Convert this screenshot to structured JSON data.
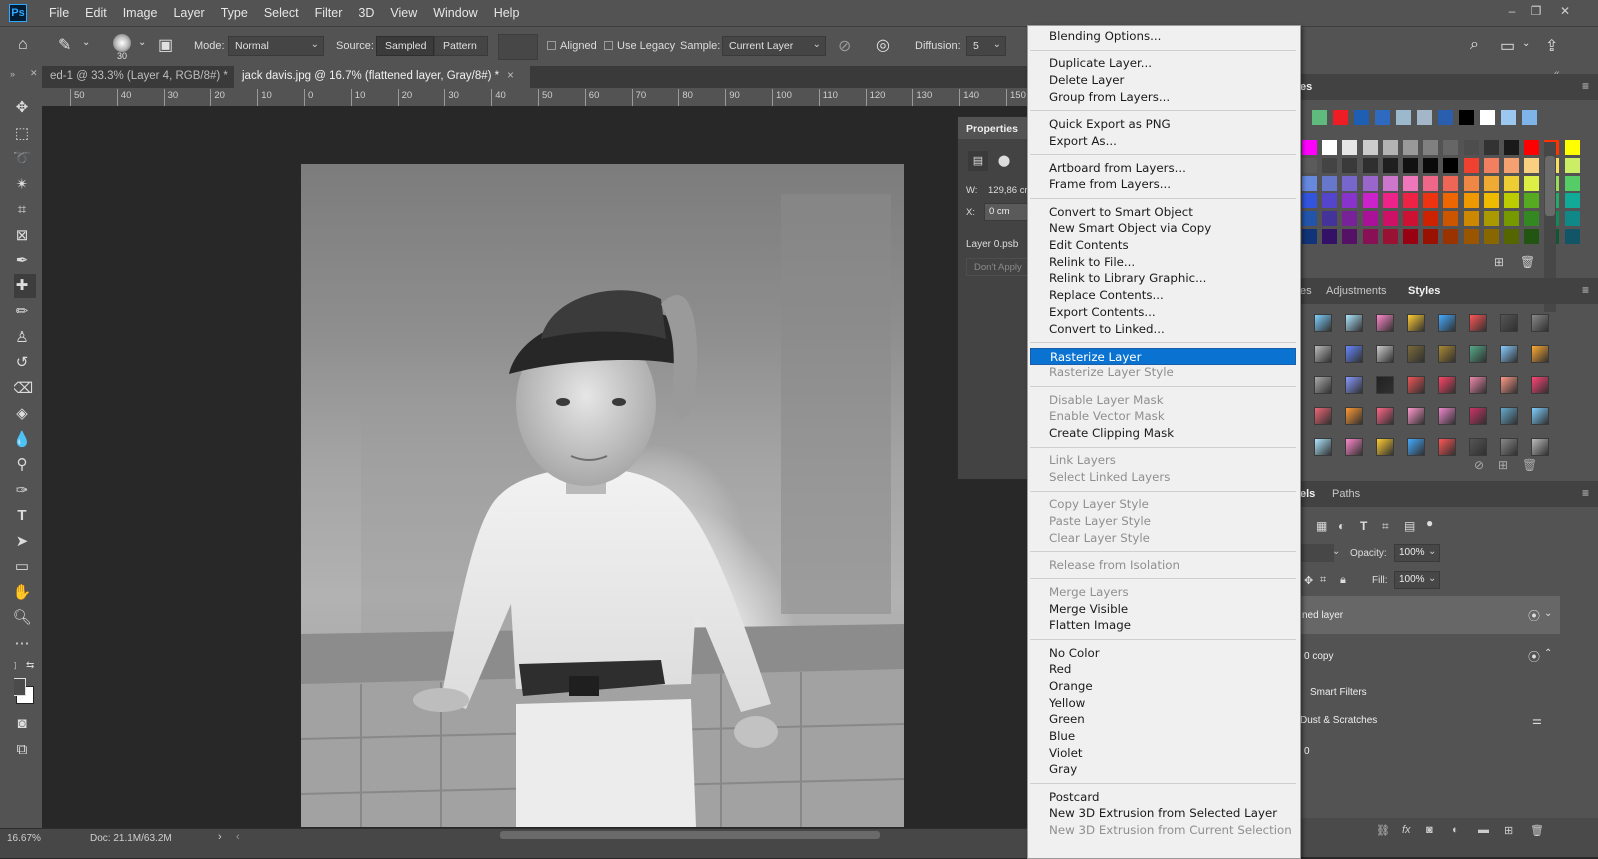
{
  "app": {
    "logo": "Ps"
  },
  "menubar": {
    "items": [
      "File",
      "Edit",
      "Image",
      "Layer",
      "Type",
      "Select",
      "Filter",
      "3D",
      "View",
      "Window",
      "Help"
    ]
  },
  "options": {
    "brush_size": "30",
    "mode_label": "Mode:",
    "mode_value": "Normal",
    "source_label": "Source:",
    "source_sampled": "Sampled",
    "source_pattern": "Pattern",
    "aligned_label": "Aligned",
    "use_legacy_label": "Use Legacy",
    "sample_label": "Sample:",
    "sample_value": "Current Layer",
    "diffusion_label": "Diffusion:",
    "diffusion_value": "5"
  },
  "tabs": [
    {
      "label": "ed-1 @ 33.3% (Layer 4, RGB/8#) *",
      "close": "×"
    },
    {
      "label": "jack davis.jpg @ 16.7% (flattened layer, Gray/8#) *",
      "close": "×"
    }
  ],
  "ruler": {
    "h_labels": [
      "50",
      "40",
      "30",
      "20",
      "10",
      "0",
      "10",
      "20",
      "30",
      "40",
      "50",
      "60",
      "70",
      "80",
      "90",
      "100",
      "110",
      "120",
      "130",
      "140",
      "150"
    ]
  },
  "status": {
    "zoom": "16.67%",
    "doc": "Doc: 21.1M/63.2M"
  },
  "properties": {
    "title": "Properties",
    "w_label": "W:",
    "w_value": "129,86 cr",
    "x_label": "X:",
    "x_value": "0 cm",
    "layer_name": "Layer 0.psb",
    "dont_apply": "Don't Apply"
  },
  "panels": {
    "swatches_tab": "es",
    "style_tabs": [
      "es",
      "Adjustments",
      "Styles"
    ],
    "layer_tabs": [
      "els",
      "Paths"
    ],
    "opacity_label": "Opacity:",
    "opacity_value": "100%",
    "fill_label": "Fill:",
    "fill_value": "100%",
    "layers": [
      "ned layer",
      "0 copy",
      "Smart Filters",
      "Dust & Scratches",
      "0"
    ]
  },
  "context_menu": {
    "items": [
      {
        "label": "Blending Options...",
        "disabled": false
      },
      {
        "sep": true
      },
      {
        "label": "Duplicate Layer...",
        "disabled": false
      },
      {
        "label": "Delete Layer",
        "disabled": false
      },
      {
        "label": "Group from Layers...",
        "disabled": false
      },
      {
        "sep": true
      },
      {
        "label": "Quick Export as PNG",
        "disabled": false
      },
      {
        "label": "Export As...",
        "disabled": false
      },
      {
        "sep": true
      },
      {
        "label": "Artboard from Layers...",
        "disabled": false
      },
      {
        "label": "Frame from Layers...",
        "disabled": false
      },
      {
        "sep": true
      },
      {
        "label": "Convert to Smart Object",
        "disabled": false
      },
      {
        "label": "New Smart Object via Copy",
        "disabled": false
      },
      {
        "label": "Edit Contents",
        "disabled": false
      },
      {
        "label": "Relink to File...",
        "disabled": false
      },
      {
        "label": "Relink to Library Graphic...",
        "disabled": false
      },
      {
        "label": "Replace Contents...",
        "disabled": false
      },
      {
        "label": "Export Contents...",
        "disabled": false
      },
      {
        "label": "Convert to Linked...",
        "disabled": false
      },
      {
        "sep": true
      },
      {
        "label": "Rasterize Layer",
        "disabled": false,
        "highlighted": true
      },
      {
        "label": "Rasterize Layer Style",
        "disabled": true
      },
      {
        "sep": true
      },
      {
        "label": "Disable Layer Mask",
        "disabled": true
      },
      {
        "label": "Enable Vector Mask",
        "disabled": true
      },
      {
        "label": "Create Clipping Mask",
        "disabled": false
      },
      {
        "sep": true
      },
      {
        "label": "Link Layers",
        "disabled": true
      },
      {
        "label": "Select Linked Layers",
        "disabled": true
      },
      {
        "sep": true
      },
      {
        "label": "Copy Layer Style",
        "disabled": true
      },
      {
        "label": "Paste Layer Style",
        "disabled": true
      },
      {
        "label": "Clear Layer Style",
        "disabled": true
      },
      {
        "sep": true
      },
      {
        "label": "Release from Isolation",
        "disabled": true
      },
      {
        "sep": true
      },
      {
        "label": "Merge Layers",
        "disabled": true
      },
      {
        "label": "Merge Visible",
        "disabled": false
      },
      {
        "label": "Flatten Image",
        "disabled": false
      },
      {
        "sep": true
      },
      {
        "label": "No Color",
        "disabled": false
      },
      {
        "label": "Red",
        "disabled": false
      },
      {
        "label": "Orange",
        "disabled": false
      },
      {
        "label": "Yellow",
        "disabled": false
      },
      {
        "label": "Green",
        "disabled": false
      },
      {
        "label": "Blue",
        "disabled": false
      },
      {
        "label": "Violet",
        "disabled": false
      },
      {
        "label": "Gray",
        "disabled": false
      },
      {
        "sep": true
      },
      {
        "label": "Postcard",
        "disabled": false
      },
      {
        "label": "New 3D Extrusion from Selected Layer",
        "disabled": false
      },
      {
        "label": "New 3D Extrusion from Current Selection",
        "disabled": true
      }
    ]
  },
  "colors": {
    "highlight": "#0a73d1",
    "ui_bg": "#535353",
    "canvas_bg": "#282828"
  }
}
